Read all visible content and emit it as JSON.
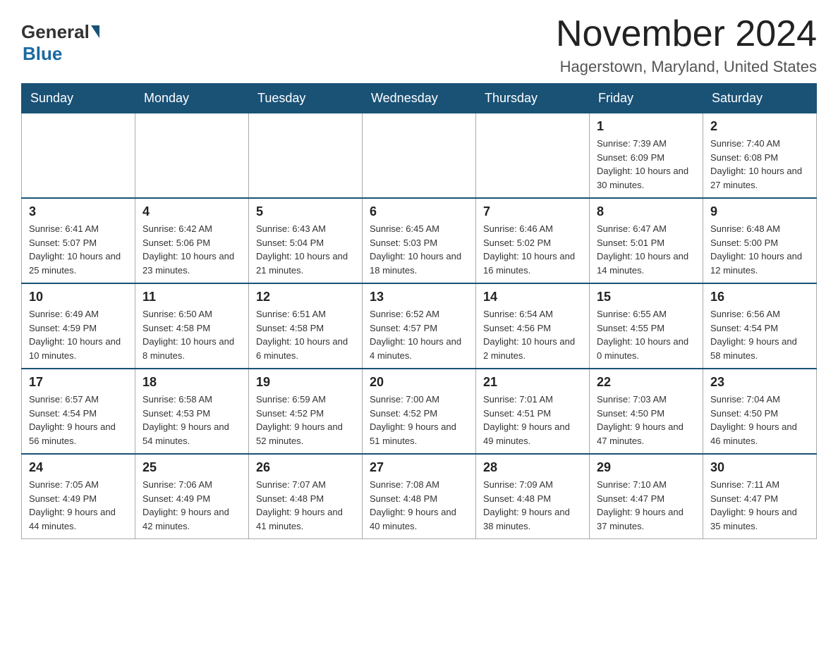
{
  "header": {
    "logo": {
      "general": "General",
      "blue": "Blue"
    },
    "title": "November 2024",
    "location": "Hagerstown, Maryland, United States"
  },
  "calendar": {
    "days_of_week": [
      "Sunday",
      "Monday",
      "Tuesday",
      "Wednesday",
      "Thursday",
      "Friday",
      "Saturday"
    ],
    "weeks": [
      [
        {
          "day": "",
          "info": ""
        },
        {
          "day": "",
          "info": ""
        },
        {
          "day": "",
          "info": ""
        },
        {
          "day": "",
          "info": ""
        },
        {
          "day": "",
          "info": ""
        },
        {
          "day": "1",
          "info": "Sunrise: 7:39 AM\nSunset: 6:09 PM\nDaylight: 10 hours and 30 minutes."
        },
        {
          "day": "2",
          "info": "Sunrise: 7:40 AM\nSunset: 6:08 PM\nDaylight: 10 hours and 27 minutes."
        }
      ],
      [
        {
          "day": "3",
          "info": "Sunrise: 6:41 AM\nSunset: 5:07 PM\nDaylight: 10 hours and 25 minutes."
        },
        {
          "day": "4",
          "info": "Sunrise: 6:42 AM\nSunset: 5:06 PM\nDaylight: 10 hours and 23 minutes."
        },
        {
          "day": "5",
          "info": "Sunrise: 6:43 AM\nSunset: 5:04 PM\nDaylight: 10 hours and 21 minutes."
        },
        {
          "day": "6",
          "info": "Sunrise: 6:45 AM\nSunset: 5:03 PM\nDaylight: 10 hours and 18 minutes."
        },
        {
          "day": "7",
          "info": "Sunrise: 6:46 AM\nSunset: 5:02 PM\nDaylight: 10 hours and 16 minutes."
        },
        {
          "day": "8",
          "info": "Sunrise: 6:47 AM\nSunset: 5:01 PM\nDaylight: 10 hours and 14 minutes."
        },
        {
          "day": "9",
          "info": "Sunrise: 6:48 AM\nSunset: 5:00 PM\nDaylight: 10 hours and 12 minutes."
        }
      ],
      [
        {
          "day": "10",
          "info": "Sunrise: 6:49 AM\nSunset: 4:59 PM\nDaylight: 10 hours and 10 minutes."
        },
        {
          "day": "11",
          "info": "Sunrise: 6:50 AM\nSunset: 4:58 PM\nDaylight: 10 hours and 8 minutes."
        },
        {
          "day": "12",
          "info": "Sunrise: 6:51 AM\nSunset: 4:58 PM\nDaylight: 10 hours and 6 minutes."
        },
        {
          "day": "13",
          "info": "Sunrise: 6:52 AM\nSunset: 4:57 PM\nDaylight: 10 hours and 4 minutes."
        },
        {
          "day": "14",
          "info": "Sunrise: 6:54 AM\nSunset: 4:56 PM\nDaylight: 10 hours and 2 minutes."
        },
        {
          "day": "15",
          "info": "Sunrise: 6:55 AM\nSunset: 4:55 PM\nDaylight: 10 hours and 0 minutes."
        },
        {
          "day": "16",
          "info": "Sunrise: 6:56 AM\nSunset: 4:54 PM\nDaylight: 9 hours and 58 minutes."
        }
      ],
      [
        {
          "day": "17",
          "info": "Sunrise: 6:57 AM\nSunset: 4:54 PM\nDaylight: 9 hours and 56 minutes."
        },
        {
          "day": "18",
          "info": "Sunrise: 6:58 AM\nSunset: 4:53 PM\nDaylight: 9 hours and 54 minutes."
        },
        {
          "day": "19",
          "info": "Sunrise: 6:59 AM\nSunset: 4:52 PM\nDaylight: 9 hours and 52 minutes."
        },
        {
          "day": "20",
          "info": "Sunrise: 7:00 AM\nSunset: 4:52 PM\nDaylight: 9 hours and 51 minutes."
        },
        {
          "day": "21",
          "info": "Sunrise: 7:01 AM\nSunset: 4:51 PM\nDaylight: 9 hours and 49 minutes."
        },
        {
          "day": "22",
          "info": "Sunrise: 7:03 AM\nSunset: 4:50 PM\nDaylight: 9 hours and 47 minutes."
        },
        {
          "day": "23",
          "info": "Sunrise: 7:04 AM\nSunset: 4:50 PM\nDaylight: 9 hours and 46 minutes."
        }
      ],
      [
        {
          "day": "24",
          "info": "Sunrise: 7:05 AM\nSunset: 4:49 PM\nDaylight: 9 hours and 44 minutes."
        },
        {
          "day": "25",
          "info": "Sunrise: 7:06 AM\nSunset: 4:49 PM\nDaylight: 9 hours and 42 minutes."
        },
        {
          "day": "26",
          "info": "Sunrise: 7:07 AM\nSunset: 4:48 PM\nDaylight: 9 hours and 41 minutes."
        },
        {
          "day": "27",
          "info": "Sunrise: 7:08 AM\nSunset: 4:48 PM\nDaylight: 9 hours and 40 minutes."
        },
        {
          "day": "28",
          "info": "Sunrise: 7:09 AM\nSunset: 4:48 PM\nDaylight: 9 hours and 38 minutes."
        },
        {
          "day": "29",
          "info": "Sunrise: 7:10 AM\nSunset: 4:47 PM\nDaylight: 9 hours and 37 minutes."
        },
        {
          "day": "30",
          "info": "Sunrise: 7:11 AM\nSunset: 4:47 PM\nDaylight: 9 hours and 35 minutes."
        }
      ]
    ]
  }
}
